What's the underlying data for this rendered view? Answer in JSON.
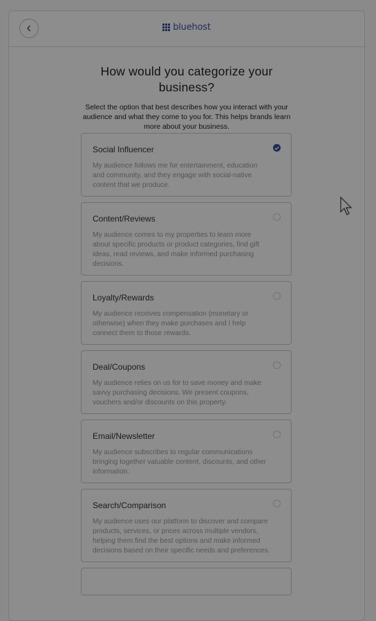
{
  "header": {
    "back_icon": "chevron-left-icon",
    "logo_text": "bluehost"
  },
  "main": {
    "title": "How would you categorize your business?",
    "subtitle": "Select the option that best describes how you interact with your audience and what they come to you for. This helps brands learn more about your business."
  },
  "options": [
    {
      "title": "Social Influencer",
      "description": "My audience follows me for entertainment, education and community, and they engage with social-native content that we produce.",
      "selected": true
    },
    {
      "title": "Content/Reviews",
      "description": "My audience comes to my properties to learn more about specific products or product categories, find gift ideas, read reviews, and make informed purchasing decisions.",
      "selected": false
    },
    {
      "title": "Loyalty/Rewards",
      "description": "My audience receives compensation (monetary or otherwise) when they make purchases and I help connect them to those rewards.",
      "selected": false
    },
    {
      "title": "Deal/Coupons",
      "description": "My audience relies on us for to save money and make savvy purchasing decisions. We present coupons, vouchers and/or discounts on this property.",
      "selected": false
    },
    {
      "title": "Email/Newsletter",
      "description": "My audience subscribes to regular communications bringing together valuable content, discounts, and other information.",
      "selected": false
    },
    {
      "title": "Search/Comparison",
      "description": "My audience uses our platform to discover and compare products, services, or prices across multiple vendors, helping them find the best options and make informed decisions based on their specific needs and preferences.",
      "selected": false
    }
  ],
  "colors": {
    "overlay": "#8d8d8d",
    "brand": "#1d2c56"
  }
}
